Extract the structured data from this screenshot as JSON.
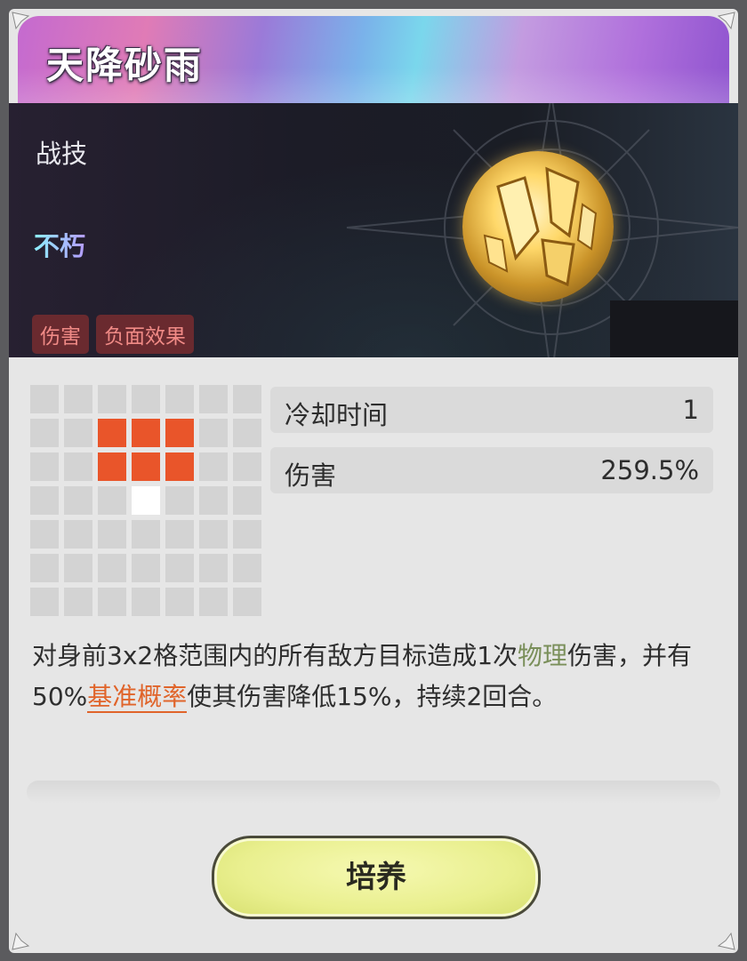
{
  "skill": {
    "name": "天降砂雨",
    "type": "战技",
    "rarity": "不朽",
    "tags": [
      "伤害",
      "负面效果"
    ]
  },
  "range_grid": {
    "rows": 7,
    "cols": 7,
    "hit_cells": [
      [
        1,
        2
      ],
      [
        1,
        3
      ],
      [
        1,
        4
      ],
      [
        2,
        2
      ],
      [
        2,
        3
      ],
      [
        2,
        4
      ]
    ],
    "self_cell": [
      3,
      3
    ],
    "colors": {
      "hit": "#e9552a",
      "self": "#ffffff",
      "empty": "#d3d3d3"
    }
  },
  "stats": [
    {
      "label": "冷却时间",
      "value": "1"
    },
    {
      "label": "伤害",
      "value": "259.5%"
    }
  ],
  "description": {
    "p1": "对身前3x2格范围内的所有敌方目标造成1次",
    "kw_damage_type": "物理",
    "p2": "伤害，并有50%",
    "kw_link": "基准概率",
    "p3": "使其伤害降低15%，持续2回合。"
  },
  "actions": {
    "cultivate_label": "培养"
  },
  "icons": {
    "corner": "ornament-corner-icon",
    "skill_emblem": "sand-rain-skill-icon",
    "background_star": "compass-star-icon"
  }
}
